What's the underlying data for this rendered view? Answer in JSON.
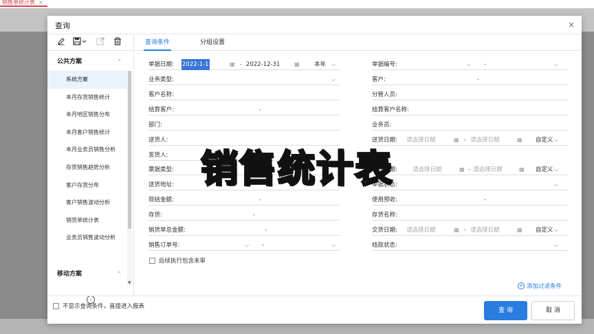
{
  "background": {
    "tab_label": "销售单统计表",
    "tab_close": "×"
  },
  "dialog": {
    "title": "查询",
    "close": "×",
    "toolbar": {
      "edit_icon": "pencil-icon",
      "save_icon": "save-icon",
      "export_icon": "export-icon",
      "delete_icon": "trash-icon"
    },
    "public_group": {
      "label": "公共方案",
      "chevron": "⌃"
    },
    "plans": [
      "系统方案",
      "本月存货销售统计",
      "本月地区销售分布",
      "本月客户销售统计",
      "本月业务员销售分析",
      "存货销售趋势分析",
      "客户存货分布",
      "客户销售波动分析",
      "销货单统计表",
      "业务员销售波动分析"
    ],
    "mobile_group": {
      "label": "移动方案",
      "chevron": "⌃"
    },
    "tabs": [
      "查询条件",
      "分组设置"
    ],
    "left_fields": [
      {
        "label": "单据日期:",
        "from": "2022-1-1",
        "to": "2022-12-31",
        "period": "本年"
      },
      {
        "label": "业务类型:"
      },
      {
        "label": "客户名称:"
      },
      {
        "label": "结算客户:",
        "dash": "-"
      },
      {
        "label": "部门:"
      },
      {
        "label": "送货人:"
      },
      {
        "label": "发货人:"
      },
      {
        "label": "票据类型:"
      },
      {
        "label": "送货地址:"
      },
      {
        "label": "现结金额:",
        "dash": "-"
      },
      {
        "label": "存货:",
        "dash": "-"
      },
      {
        "label": "销货单总金额:",
        "dash": "-"
      },
      {
        "label": "销售订单号:",
        "dash": "-"
      }
    ],
    "right_fields": [
      {
        "label": "单据编号:",
        "dash": "-"
      },
      {
        "label": "客户:",
        "dash": "-"
      },
      {
        "label": "分管人员:"
      },
      {
        "label": "结算客户名称:"
      },
      {
        "label": "业务员:"
      },
      {
        "label": "送货日期:",
        "placeholder": "请选择日期",
        "period": "自定义"
      },
      {
        "label": "审核日期:",
        "placeholder": "请选择日期",
        "period": "自定义"
      },
      {
        "label": "单据状态:"
      },
      {
        "label": "使用预收:",
        "dash": "-"
      },
      {
        "label": "存货名称:"
      },
      {
        "label": "交货日期:",
        "placeholder": "请选择日期",
        "period": "自定义"
      },
      {
        "label": "结款状态:"
      }
    ],
    "include_unaudited": "后续执行包含未审",
    "add_filter": "添加过滤条件",
    "footer": {
      "skip_query": "不显示查询条件，直接进入报表",
      "ok": "查 询",
      "cancel": "取 消"
    }
  },
  "overlay_caption": "销售统计表",
  "colors": {
    "accent": "#2a7ce0",
    "overlay_text": "#f5e61a",
    "tab_red": "#d0454c"
  }
}
